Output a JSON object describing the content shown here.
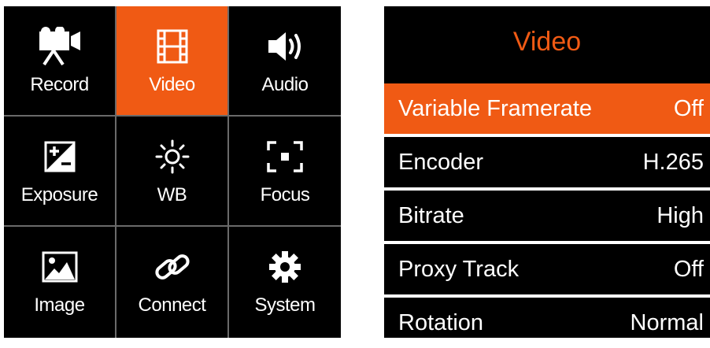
{
  "menu": {
    "items": [
      {
        "label": "Record",
        "icon": "video-camera-icon"
      },
      {
        "label": "Video",
        "icon": "film-strip-icon"
      },
      {
        "label": "Audio",
        "icon": "speaker-icon"
      },
      {
        "label": "Exposure",
        "icon": "exposure-icon"
      },
      {
        "label": "WB",
        "icon": "sun-icon"
      },
      {
        "label": "Focus",
        "icon": "focus-frame-icon"
      },
      {
        "label": "Image",
        "icon": "picture-icon"
      },
      {
        "label": "Connect",
        "icon": "link-icon"
      },
      {
        "label": "System",
        "icon": "gear-icon"
      }
    ],
    "selected": "Video"
  },
  "panel": {
    "title": "Video",
    "rows": [
      {
        "label": "Variable Framerate",
        "value": "Off"
      },
      {
        "label": "Encoder",
        "value": "H.265"
      },
      {
        "label": "Bitrate",
        "value": "High"
      },
      {
        "label": "Proxy Track",
        "value": "Off"
      },
      {
        "label": "Rotation",
        "value": "Normal"
      }
    ],
    "selected": "Variable Framerate"
  },
  "colors": {
    "accent": "#f05a14",
    "background": "#000000",
    "text": "#ffffff",
    "divider": "#6a6a6a"
  }
}
